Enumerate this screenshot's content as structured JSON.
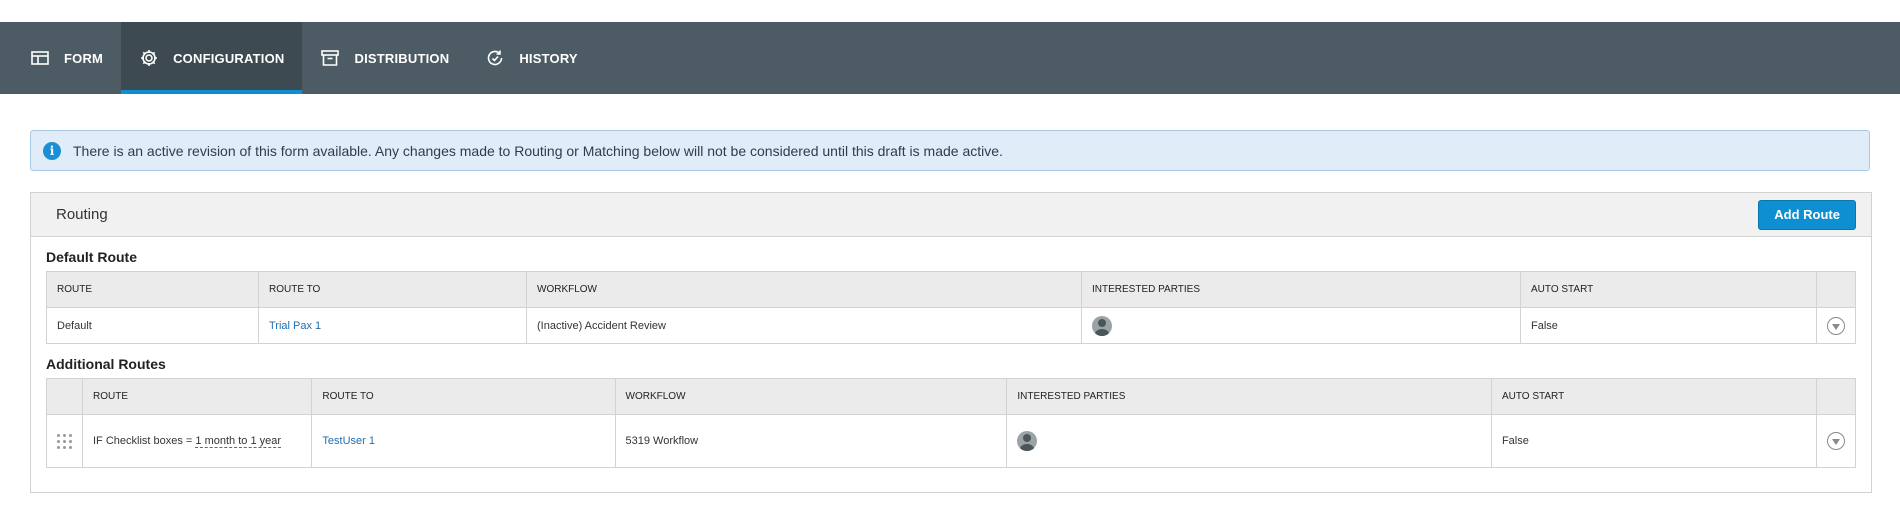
{
  "tabs": [
    {
      "label": "FORM",
      "icon": "table-icon",
      "active": false
    },
    {
      "label": "CONFIGURATION",
      "icon": "gear-icon",
      "active": true
    },
    {
      "label": "DISTRIBUTION",
      "icon": "archive-icon",
      "active": false
    },
    {
      "label": "HISTORY",
      "icon": "history-icon",
      "active": false
    }
  ],
  "alert": {
    "icon": "info-icon",
    "glyph": "i",
    "text": "There is an active revision of this form available. Any changes made to Routing or Matching below will not be considered until this draft is made active."
  },
  "routing": {
    "title": "Routing",
    "add_button": "Add Route",
    "default_section": {
      "title": "Default Route",
      "headers": [
        "ROUTE",
        "ROUTE TO",
        "WORKFLOW",
        "INTERESTED PARTIES",
        "AUTO START"
      ],
      "rows": [
        {
          "route": "Default",
          "route_to": "Trial Pax 1",
          "workflow": "(Inactive) Accident Review",
          "auto_start": "False"
        }
      ]
    },
    "additional_section": {
      "title": "Additional Routes",
      "headers": [
        "ROUTE",
        "ROUTE TO",
        "WORKFLOW",
        "INTERESTED PARTIES",
        "AUTO START"
      ],
      "rows": [
        {
          "route_prefix": "IF Checklist boxes = ",
          "route_value": "1 month to 1 year",
          "route_to": "TestUser 1",
          "workflow": "5319 Workflow",
          "auto_start": "False"
        }
      ]
    }
  },
  "colors": {
    "tabbar": "#4d5c64",
    "accent": "#0e8fd1",
    "alert_bg": "#e0ecf7",
    "link": "#1f6fb2"
  }
}
